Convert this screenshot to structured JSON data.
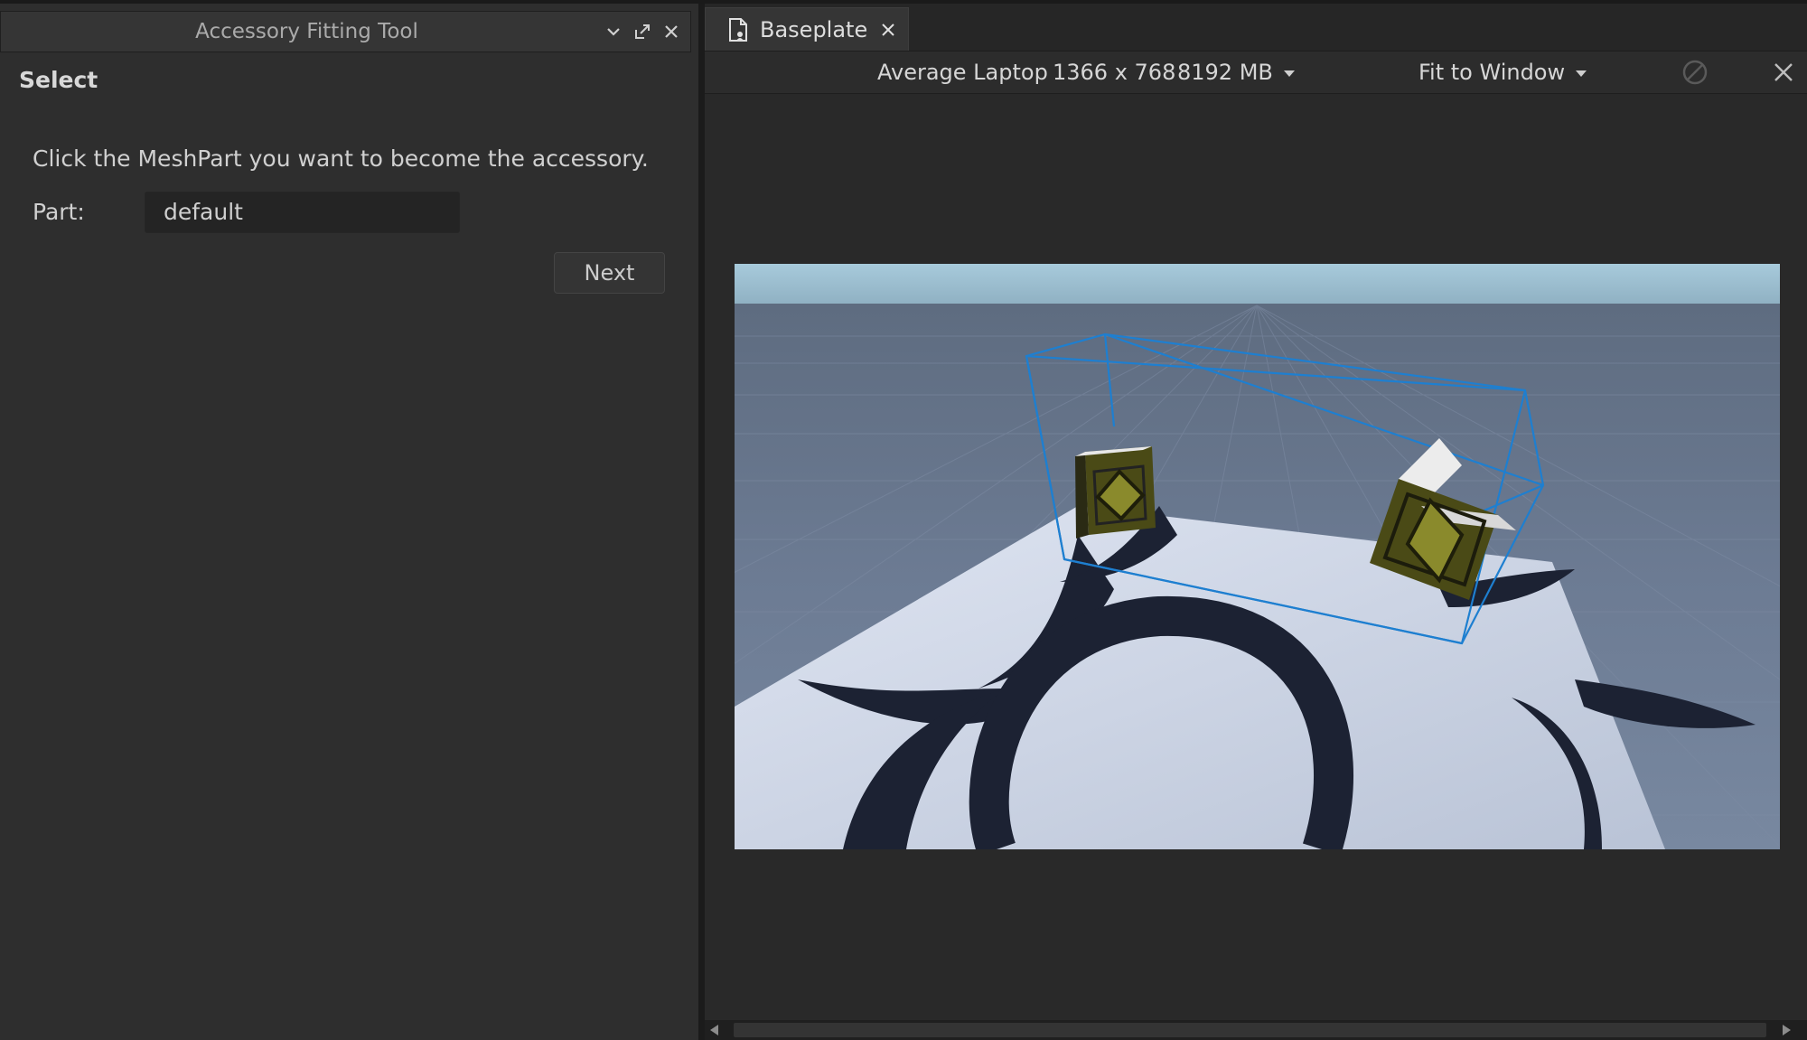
{
  "fitting_tool": {
    "title": "Accessory Fitting Tool",
    "section": "Select",
    "instruction": "Click the MeshPart you want to become the accessory.",
    "part_label": "Part:",
    "part_value": "default",
    "next_label": "Next"
  },
  "document_tab": {
    "label": "Baseplate"
  },
  "device_bar": {
    "device": "Average Laptop",
    "resolution": "1366 x 768",
    "memory": "8192 MB",
    "fit_mode": "Fit to Window"
  },
  "icons": {
    "collapse": "chevron-down-icon",
    "undock": "undock-icon",
    "close": "close-icon",
    "document": "document-icon",
    "rotate": "rotate-disabled-icon"
  },
  "colors": {
    "selection_box": "#1e7fd0",
    "book_cover": "#4a4a16",
    "sky": "#9dc0d4",
    "baseplate_tile": "#6b7b95"
  }
}
